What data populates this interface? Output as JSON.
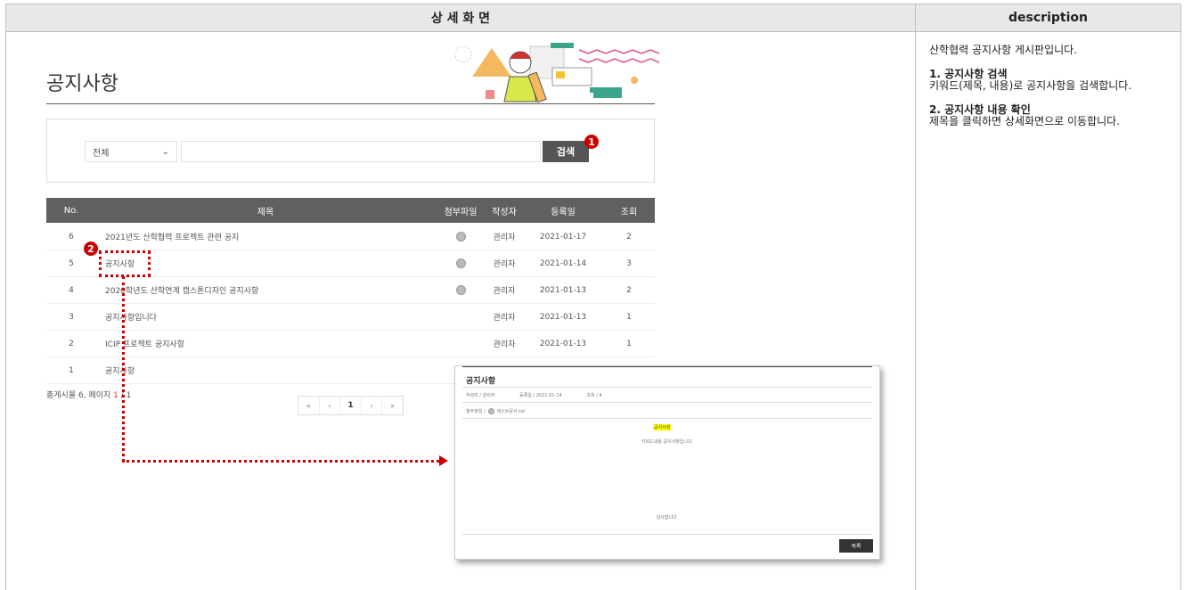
{
  "header": {
    "left_title": "상 세 화 면",
    "right_title": "description"
  },
  "description": {
    "intro": "산학협력 공지사항 게시판입니다.",
    "item1_title": "1. 공지사항 검색",
    "item1_body": "키워드(제목, 내용)로 공지사항을 검색합니다.",
    "item2_title": "2. 공지사항 내용 확인",
    "item2_body": "제목을 클릭하면 상세화면으로 이동합니다."
  },
  "page": {
    "title": "공지사항"
  },
  "search": {
    "select_value": "전체",
    "input_value": "",
    "button_label": "검색",
    "badge": "1"
  },
  "table": {
    "headers": {
      "no": "No.",
      "title": "제목",
      "attachment": "첨부파일",
      "author": "작성자",
      "date": "등록일",
      "views": "조회"
    },
    "rows": [
      {
        "no": "6",
        "title": "2021년도 산학협력 프로젝트 관련 공지",
        "attachment": true,
        "author": "관리자",
        "date": "2021-01-17",
        "views": "2"
      },
      {
        "no": "5",
        "title": "공지사항",
        "attachment": true,
        "author": "관리자",
        "date": "2021-01-14",
        "views": "3"
      },
      {
        "no": "4",
        "title": "2020학년도 산학연계 캡스톤디자인 공지사항",
        "attachment": true,
        "author": "관리자",
        "date": "2021-01-13",
        "views": "2"
      },
      {
        "no": "3",
        "title": "공지사항입니다",
        "attachment": false,
        "author": "관리자",
        "date": "2021-01-13",
        "views": "1"
      },
      {
        "no": "2",
        "title": "ICIP 프로젝트 공지사항",
        "attachment": false,
        "author": "관리자",
        "date": "2021-01-13",
        "views": "1"
      },
      {
        "no": "1",
        "title": "공지사항",
        "attachment": false,
        "author": "",
        "date": "",
        "views": ""
      }
    ],
    "badge2": "2"
  },
  "footer": {
    "total_prefix": "총게시물 6, 페이지 ",
    "current_page": "1",
    "total_suffix": " / 1"
  },
  "pager": {
    "first": "«",
    "prev": "‹",
    "current": "1",
    "next": "›",
    "last": "»"
  },
  "popup": {
    "title": "공지사항",
    "author_label": "작성자 / 관리자",
    "date_label": "등록일 / 2021-01-14",
    "views_label": "조회 / 4",
    "attach_label": "첨부파일 /",
    "attach_file": "테스트문서.txt",
    "highlight": "공지사항",
    "body1": "키워드내용 공지사항입니다.",
    "body2": "감사합니다.",
    "list_button": "목록"
  },
  "colors": {
    "accent_red": "#cc0000",
    "header_bg": "#606060",
    "highlight": "#ffff00"
  }
}
